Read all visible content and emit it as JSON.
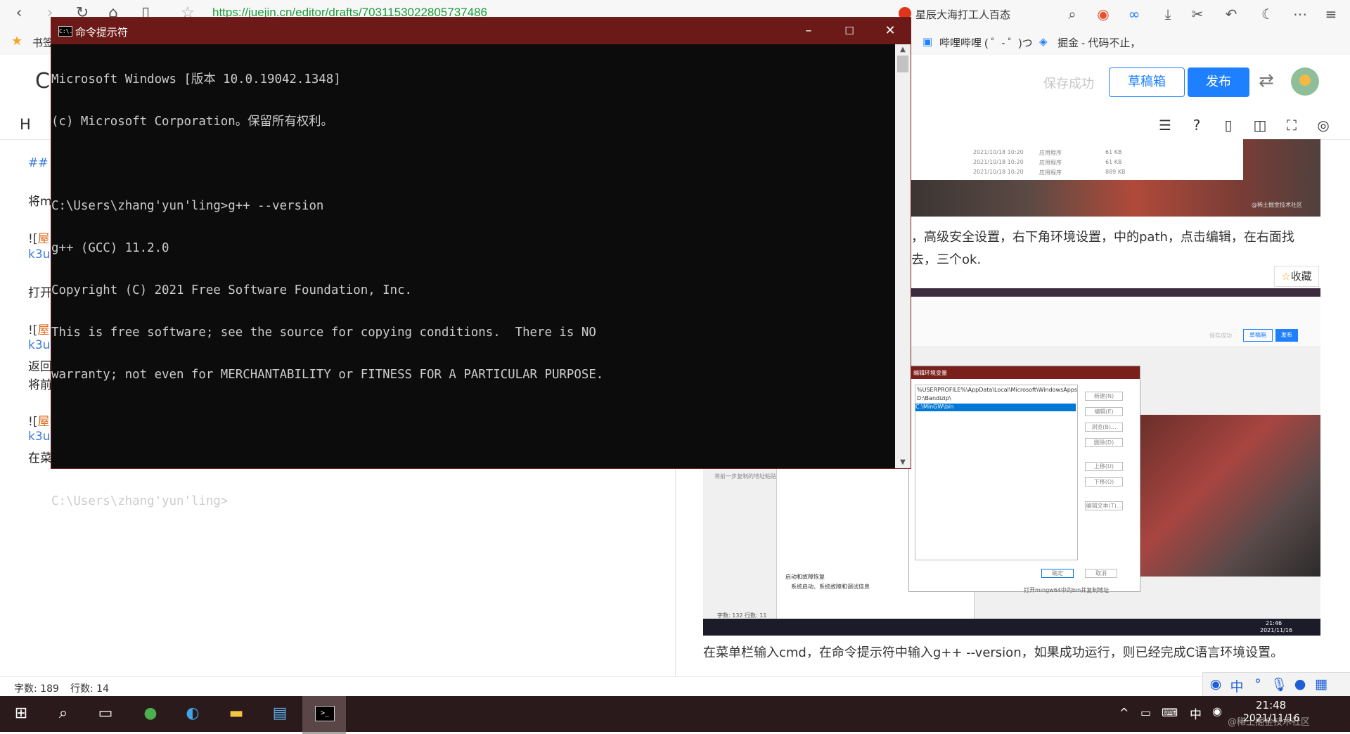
{
  "browser": {
    "url": "https://juejin.cn/editor/drafts/7031153022805737486",
    "tab_title": "星辰大海打工人百态",
    "bookmarks": {
      "label": "书签",
      "bilibili": "哔哩哔哩 ( ゜- ゜)つ",
      "juejin": "掘金 - 代码不止，"
    }
  },
  "editor": {
    "save_status": "保存成功",
    "drafts_label": "草稿箱",
    "publish_label": "发布",
    "toolbar_heading": "H",
    "title_fragment": "C",
    "lines": {
      "l1": "##",
      "l2": "将mi",
      "l3a": "![",
      "l3b": "屋",
      "l4": "k3u",
      "l5": "打开",
      "l6a": "![",
      "l6b": "屋",
      "l7": "k3u",
      "l8": "返回",
      "l9": "将前",
      "l10a": "![",
      "l10b": "屋",
      "l11": "k3u",
      "l12": "在菜"
    },
    "status": {
      "word_count": "字数: 189",
      "line_count": "行数: 14"
    }
  },
  "preview": {
    "paragraph_1_line1": "，高级安全设置，右下角环境设置，中的path，点击编辑，在右面找",
    "paragraph_1_line2": "去，三个ok.",
    "favorite_label": "收藏",
    "caption": "在菜单栏输入cmd，在命令提示符中输入g++ --version，如果成功运行，则已经完成C语言环境设置。",
    "screenshot": {
      "dialog_title": "编辑环境变量",
      "paths": [
        "%USERPROFILE%\\AppData\\Local\\Microsoft\\WindowsApps",
        "D:\\Bandizip\\",
        "C:\\MinGW\\bin"
      ],
      "buttons": [
        "新建(N)",
        "编辑(E)",
        "浏览(B)...",
        "删除(D)",
        "上移(U)",
        "下移(O)",
        "编辑文本(T)..."
      ],
      "ok": "确定",
      "cancel": "取消",
      "note": "打开mingw64中的bin并复制地址",
      "startup": "启动和故障恢复",
      "startup_desc": "系统启动、系统故障和调试信息",
      "hint1": "请将获得地址复制到环境",
      "hint2": "将前一步复制的地址粘贴",
      "mini_status": "字数: 132    行数: 11",
      "mini_time": "21:46",
      "mini_date": "2021/11/16",
      "draft_btn": "草稿箱",
      "publish_btn": "发布",
      "save_status": "保存成功",
      "file_dates": [
        "2021/10/18 10:20",
        "2021/10/18 10:20",
        "2021/10/18 10:20"
      ],
      "file_types": [
        "应用程序",
        "应用程序",
        "应用程序"
      ],
      "file_sizes": [
        "61 KB",
        "61 KB",
        "889 KB"
      ],
      "watermark": "@稀土掘金技术社区"
    }
  },
  "cmd": {
    "title": "命令提示符",
    "icon_text": "C:\\.",
    "lines": [
      "Microsoft Windows [版本 10.0.19042.1348]",
      "(c) Microsoft Corporation。保留所有权利。",
      "",
      "C:\\Users\\zhang'yun'ling>g++ --version",
      "g++ (GCC) 11.2.0",
      "Copyright (C) 2021 Free Software Foundation, Inc.",
      "This is free software; see the source for copying conditions.  There is NO",
      "warranty; not even for MERCHANTABILITY or FITNESS FOR A PARTICULAR PURPOSE.",
      "",
      "",
      "C:\\Users\\zhang'yun'ling>"
    ]
  },
  "taskbar": {
    "time": "21:48",
    "date": "2021/11/16",
    "ime": "中",
    "watermark": "@稀土掘金技术社区"
  }
}
